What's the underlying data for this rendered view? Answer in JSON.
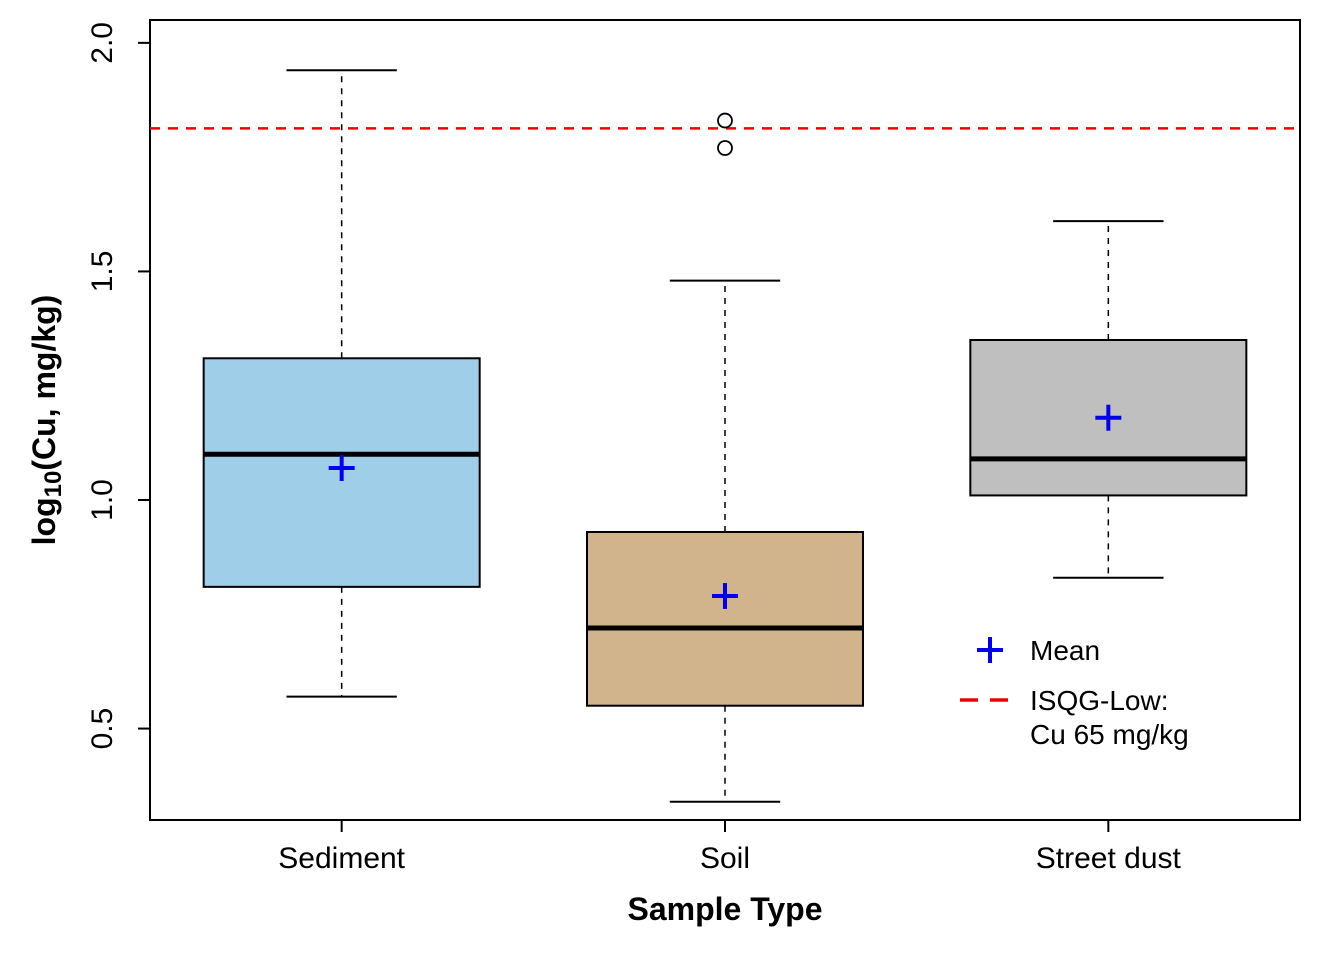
{
  "chart_data": {
    "type": "boxplot",
    "title": "",
    "xlabel": "Sample Type",
    "ylabel_prefix": "log",
    "ylabel_sub": "10",
    "ylabel_suffix": "(Cu, mg/kg)",
    "ylim": [
      0.3,
      2.05
    ],
    "yticks": [
      0.5,
      1.0,
      1.5,
      2.0
    ],
    "ytick_labels": [
      "0.5",
      "1.0",
      "1.5",
      "2.0"
    ],
    "categories": [
      "Sediment",
      "Soil",
      "Street dust"
    ],
    "reference_line": {
      "value": 1.813,
      "label": "ISQG-Low:\nCu 65 mg/kg",
      "color": "#ee0000"
    },
    "series": [
      {
        "name": "Sediment",
        "color": "#9ecee8",
        "q1": 0.81,
        "median": 1.1,
        "q3": 1.31,
        "whisker_low": 0.57,
        "whisker_high": 1.94,
        "mean": 1.07,
        "outliers": []
      },
      {
        "name": "Soil",
        "color": "#d2b48c",
        "q1": 0.55,
        "median": 0.72,
        "q3": 0.93,
        "whisker_low": 0.34,
        "whisker_high": 1.48,
        "mean": 0.79,
        "outliers": [
          1.77,
          1.83
        ]
      },
      {
        "name": "Street dust",
        "color": "#bfbfbf",
        "q1": 1.01,
        "median": 1.09,
        "q3": 1.35,
        "whisker_low": 0.83,
        "whisker_high": 1.61,
        "mean": 1.18,
        "outliers": []
      }
    ],
    "legend": {
      "mean_label": "Mean",
      "mean_color": "#0000ee"
    }
  }
}
